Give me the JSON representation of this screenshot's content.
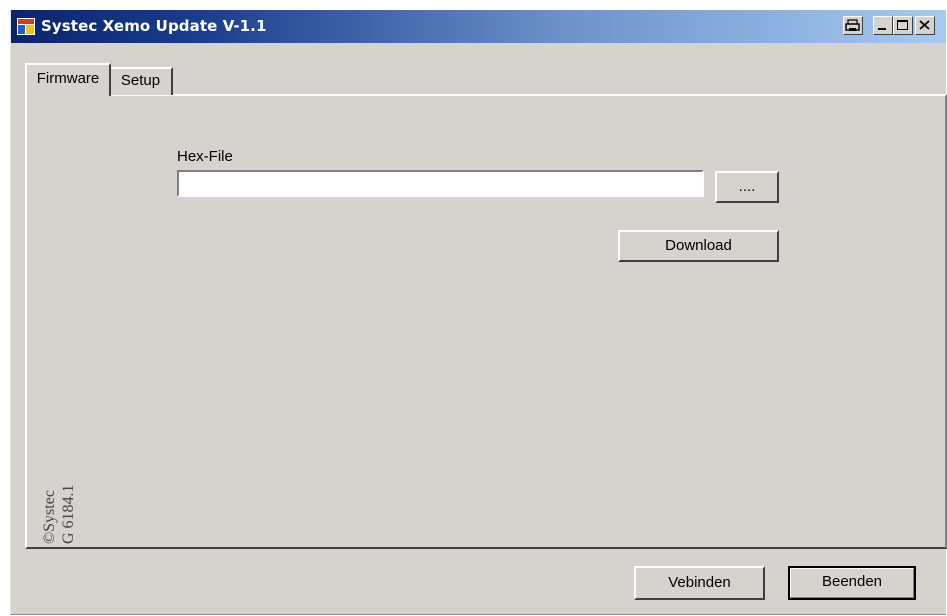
{
  "window": {
    "title": "Systec Xemo Update V-1.1",
    "icon": "app-icon",
    "controls": [
      "print-icon",
      "minimize-icon",
      "maximize-icon",
      "close-icon"
    ]
  },
  "tabs": [
    {
      "label": "Firmware",
      "active": true
    },
    {
      "label": "Setup",
      "active": false
    }
  ],
  "firmware": {
    "hex_label": "Hex-File",
    "hex_value": "",
    "browse_label": "....",
    "download_label": "Download"
  },
  "copyright": {
    "line1": "©Systec",
    "line2": "G 6184.1"
  },
  "footer": {
    "connect_label": "Vebinden",
    "exit_label": "Beenden"
  },
  "colors": {
    "face": "#d6d3ce",
    "title_start": "#0a246a",
    "title_end": "#a6caf0"
  }
}
